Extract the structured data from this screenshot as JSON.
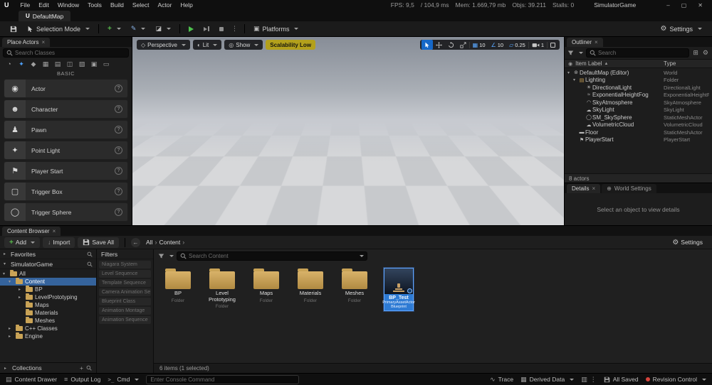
{
  "menu_bar": {
    "logo_glyph": "U",
    "items": [
      "File",
      "Edit",
      "Window",
      "Tools",
      "Build",
      "Select",
      "Actor",
      "Help"
    ],
    "stats": [
      "FPS: 9,5",
      "/ 104,9 ms",
      "Mem: 1.669,79 mb",
      "Objs: 39.211",
      "Stalls: 0"
    ],
    "window_title": "SimulatorGame",
    "minimize_glyph": "–",
    "maximize_glyph": "▢",
    "close_glyph": "✕"
  },
  "level_tab": {
    "label": "DefaultMap"
  },
  "toolbar": {
    "mode_label": "Selection Mode",
    "platforms_label": "Platforms",
    "settings_label": "Settings"
  },
  "place_actors": {
    "tab_title": "Place Actors",
    "close_glyph": "×",
    "search_placeholder": "Search Classes",
    "categories": [
      {
        "glyph": "◔",
        "cls": ""
      },
      {
        "glyph": "✦",
        "cls": "active"
      },
      {
        "glyph": "◆",
        "cls": ""
      },
      {
        "glyph": "▦",
        "cls": ""
      },
      {
        "glyph": "▤",
        "cls": ""
      },
      {
        "glyph": "◫",
        "cls": ""
      },
      {
        "glyph": "▧",
        "cls": ""
      },
      {
        "glyph": "▣",
        "cls": ""
      },
      {
        "glyph": "▭",
        "cls": ""
      }
    ],
    "section_label": "BASIC",
    "help_glyph": "?",
    "items": [
      {
        "label": "Actor",
        "glyph": "◉"
      },
      {
        "label": "Character",
        "glyph": "☻"
      },
      {
        "label": "Pawn",
        "glyph": "♟"
      },
      {
        "label": "Point Light",
        "glyph": "✦"
      },
      {
        "label": "Player Start",
        "glyph": "⚑"
      },
      {
        "label": "Trigger Box",
        "glyph": "▢"
      },
      {
        "label": "Trigger Sphere",
        "glyph": "◯"
      }
    ]
  },
  "viewport": {
    "perspective_label": "Perspective",
    "lit_label": "Lit",
    "show_label": "Show",
    "scalability_label": "Scalability Low",
    "grid_snap_value": "10",
    "rotation_snap_value": "10",
    "scale_snap_value": "0.25",
    "camera_speed_value": "1"
  },
  "outliner": {
    "tab_title": "Outliner",
    "close_glyph": "×",
    "search_placeholder": "Search",
    "item_label_header": "Item Label",
    "sort_glyph": "▲",
    "type_header": "Type",
    "eye_glyph": "◉",
    "rows": [
      {
        "arrow": "▾",
        "glyph": "⊚",
        "label": "DefaultMap (Editor)",
        "type": "World",
        "cls": "ind0"
      },
      {
        "arrow": "▾",
        "glyph": "▤",
        "label": "Lighting",
        "type": "Folder",
        "cls": "ind1 gold"
      },
      {
        "arrow": "",
        "glyph": "☀",
        "label": "DirectionalLight",
        "type": "DirectionalLight",
        "cls": "ind2"
      },
      {
        "arrow": "",
        "glyph": "≈",
        "label": "ExponentialHeightFog",
        "type": "ExponentialHeightFog",
        "cls": "ind2"
      },
      {
        "arrow": "",
        "glyph": "◠",
        "label": "SkyAtmosphere",
        "type": "SkyAtmosphere",
        "cls": "ind2"
      },
      {
        "arrow": "",
        "glyph": "☁",
        "label": "SkyLight",
        "type": "SkyLight",
        "cls": "ind2"
      },
      {
        "arrow": "",
        "glyph": "◯",
        "label": "SM_SkySphere",
        "type": "StaticMeshActor",
        "cls": "ind2"
      },
      {
        "arrow": "",
        "glyph": "☁",
        "label": "VolumetricCloud",
        "type": "VolumetricCloud",
        "cls": "ind2"
      },
      {
        "arrow": "",
        "glyph": "▬",
        "label": "Floor",
        "type": "StaticMeshActor",
        "cls": "ind1"
      },
      {
        "arrow": "",
        "glyph": "⚑",
        "label": "PlayerStart",
        "type": "PlayerStart",
        "cls": "ind1"
      }
    ],
    "footer": "8 actors"
  },
  "details": {
    "tab_title": "Details",
    "close_glyph": "×",
    "world_settings_tab": "World Settings",
    "world_settings_glyph": "⊕",
    "empty_message": "Select an object to view details"
  },
  "content_browser": {
    "tab_title": "Content Browser",
    "close_glyph": "×",
    "add_label": "Add",
    "import_label": "Import",
    "save_all_label": "Save All",
    "back_glyph": "←",
    "crumbs": [
      "All",
      "Content"
    ],
    "crumb_sep": "›",
    "settings_label": "Settings",
    "favorites_label": "Favorites",
    "favorites_arrow": "▸",
    "project_label": "SimulatorGame",
    "project_arrow": "▾",
    "tree": [
      {
        "arrow": "▾",
        "label": "All",
        "cls": "ind0"
      },
      {
        "arrow": "▾",
        "label": "Content",
        "cls": "ind1 selected"
      },
      {
        "arrow": "▸",
        "label": "BP",
        "cls": "ind2"
      },
      {
        "arrow": "▸",
        "label": "LevelPrototyping",
        "cls": "ind2"
      },
      {
        "arrow": "",
        "label": "Maps",
        "cls": "ind2"
      },
      {
        "arrow": "",
        "label": "Materials",
        "cls": "ind2"
      },
      {
        "arrow": "",
        "label": "Meshes",
        "cls": "ind2"
      },
      {
        "arrow": "▸",
        "label": "C++ Classes",
        "cls": "ind1"
      },
      {
        "arrow": "▸",
        "label": "Engine",
        "cls": "ind1"
      }
    ],
    "collections_label": "Collections",
    "collections_add_glyph": "+",
    "filters_header": "Filters",
    "filters": [
      "Niagara System",
      "Level Sequence",
      "Template Sequence",
      "Camera Animation Se",
      "Blueprint Class",
      "Animation Montage",
      "Animation Sequence"
    ],
    "search_placeholder": "Search Content",
    "folder_subtitle": "Folder",
    "folders": [
      {
        "name": "BP"
      },
      {
        "name": "Level Prototyping"
      },
      {
        "name": "Maps"
      },
      {
        "name": "Materials"
      },
      {
        "name": "Meshes"
      }
    ],
    "selected_asset": {
      "name": "BP_Test",
      "line2": "PrimaryAssetActor",
      "line3": "Blueprint"
    },
    "status": "6 items (1 selected)"
  },
  "status_bar": {
    "content_drawer_label": "Content Drawer",
    "content_drawer_glyph": "▤",
    "output_log_label": "Output Log",
    "output_log_glyph": "≡",
    "cmd_label": "Cmd",
    "cmd_glyph": ">_",
    "console_placeholder": "Enter Console Command",
    "trace_label": "Trace",
    "trace_glyph": "∿",
    "derived_data_label": "Derived Data",
    "derived_data_glyph": "▦",
    "resource_glyph": "▥",
    "kebab_glyph": "⋮",
    "all_saved_label": "All Saved",
    "revision_control_label": "Revision Control"
  }
}
